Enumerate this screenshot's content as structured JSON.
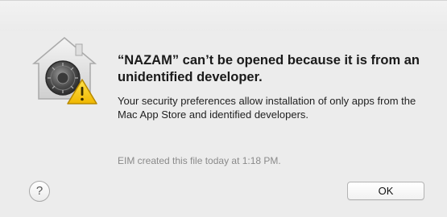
{
  "dialog": {
    "title_line": "“NAZAM” can’t be opened because it is from an unidentified developer.",
    "message": "Your security preferences allow installation of only apps from the Mac App Store and identified developers.",
    "info": "EIM created this file today at 1:18 PM.",
    "help_label": "?",
    "ok_label": "OK"
  },
  "icons": {
    "main": "gatekeeper-house-lock-icon",
    "badge": "warning-icon"
  },
  "colors": {
    "warning_yellow": "#f5c500",
    "dialog_bg": "#ececec"
  }
}
